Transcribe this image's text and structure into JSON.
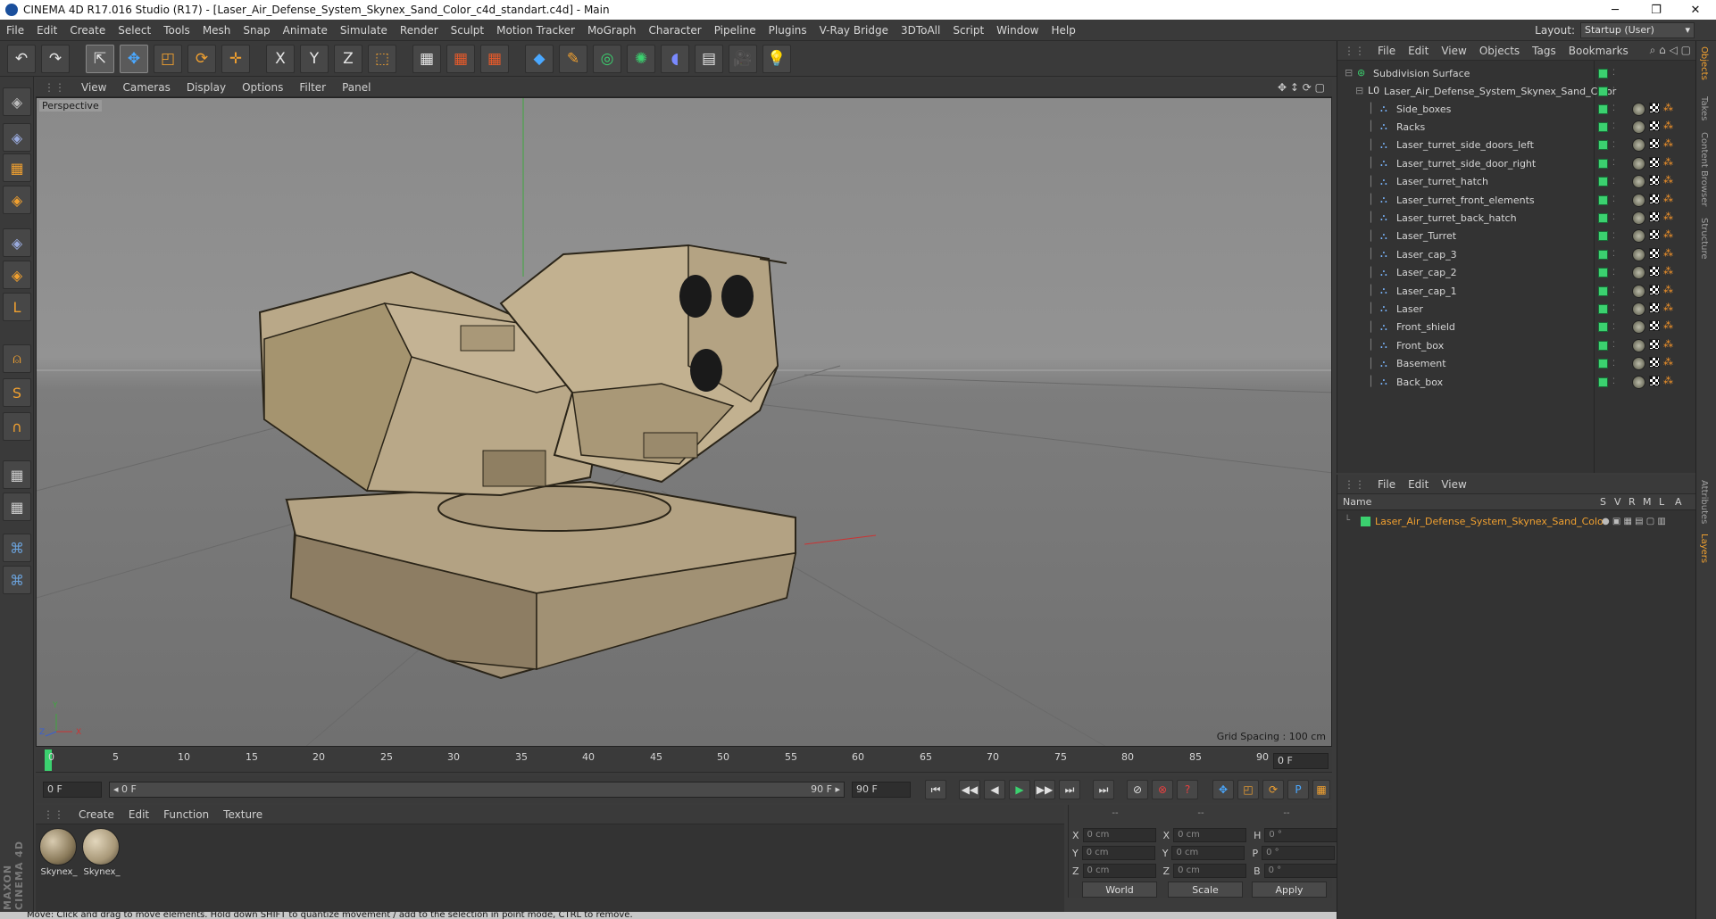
{
  "window": {
    "title": "CINEMA 4D R17.016 Studio (R17) - [Laser_Air_Defense_System_Skynex_Sand_Color_c4d_standart.c4d] - Main",
    "minimize": "─",
    "restore": "❐",
    "close": "✕"
  },
  "menu": [
    "File",
    "Edit",
    "Create",
    "Select",
    "Tools",
    "Mesh",
    "Snap",
    "Animate",
    "Simulate",
    "Render",
    "Sculpt",
    "Motion Tracker",
    "MoGraph",
    "Character",
    "Pipeline",
    "Plugins",
    "V-Ray Bridge",
    "3DToAll",
    "Script",
    "Window",
    "Help"
  ],
  "layout": {
    "label": "Layout:",
    "value": "Startup (User)"
  },
  "toolbar": {
    "undo": "↶",
    "redo": "↷",
    "select": "⇱",
    "move": "✥",
    "scale": "◰",
    "rotate": "⟳",
    "move2": "✛",
    "x": "X",
    "y": "Y",
    "z": "Z",
    "coord": "⬚",
    "render1": "▦",
    "render2": "▦",
    "render3": "▦",
    "cube": "◆",
    "pen": "✎",
    "nurbs": "◎",
    "array": "✺",
    "deform": "◖",
    "scene": "▤",
    "camera": "🎥",
    "light": "💡"
  },
  "lefttools": [
    "◈",
    "◈",
    "▦",
    "◈",
    "◈",
    "◈",
    "L",
    "⍝",
    "S",
    "∩",
    "▦",
    "▦",
    "⌘",
    "⌘"
  ],
  "maxon": "MAXON CINEMA 4D",
  "viewport": {
    "menu": [
      "View",
      "Cameras",
      "Display",
      "Options",
      "Filter",
      "Panel"
    ],
    "label": "Perspective",
    "grid": "Grid Spacing : 100 cm",
    "axes": {
      "x": "X",
      "y": "Y",
      "z": "Z"
    }
  },
  "timeline": {
    "ticks": [
      "0",
      "5",
      "10",
      "15",
      "20",
      "25",
      "30",
      "35",
      "40",
      "45",
      "50",
      "55",
      "60",
      "65",
      "70",
      "75",
      "80",
      "85",
      "90"
    ],
    "current": "0 F",
    "start": "0 F",
    "range_start": "◂ 0 F",
    "range_end": "90 F ▸",
    "end": "90 F"
  },
  "transport": [
    "⏮",
    "◀◀",
    "◀",
    "▶",
    "▶▶",
    "⏭",
    "⏭",
    "⊘",
    "⊗",
    "?",
    "✥",
    "◰",
    "⟳",
    "P",
    "▦",
    "▤"
  ],
  "materials": {
    "menu": [
      "Create",
      "Edit",
      "Function",
      "Texture"
    ],
    "items": [
      {
        "name": "Skynex_"
      },
      {
        "name": "Skynex_"
      }
    ]
  },
  "coords": {
    "head": [
      "--",
      "--",
      "--"
    ],
    "rows": [
      {
        "a": "X",
        "av": "0 cm",
        "b": "X",
        "bv": "0 cm",
        "c": "H",
        "cv": "0 °"
      },
      {
        "a": "Y",
        "av": "0 cm",
        "b": "Y",
        "bv": "0 cm",
        "c": "P",
        "cv": "0 °"
      },
      {
        "a": "Z",
        "av": "0 cm",
        "b": "Z",
        "bv": "0 cm",
        "c": "B",
        "cv": "0 °"
      }
    ],
    "space": "World",
    "mode": "Scale",
    "apply": "Apply"
  },
  "status": "Move: Click and drag to move elements. Hold down SHIFT to quantize movement / add to the selection in point mode, CTRL to remove.",
  "objects": {
    "menu": [
      "File",
      "Edit",
      "View",
      "Objects",
      "Tags",
      "Bookmarks"
    ],
    "root": "Subdivision Surface",
    "group": "Laser_Air_Defense_System_Skynex_Sand_Color",
    "children": [
      "Side_boxes",
      "Racks",
      "Laser_turret_side_doors_left",
      "Laser_turret_side_door_right",
      "Laser_turret_hatch",
      "Laser_turret_front_elements",
      "Laser_turret_back_hatch",
      "Laser_Turret",
      "Laser_cap_3",
      "Laser_cap_2",
      "Laser_cap_1",
      "Laser",
      "Front_shield",
      "Front_box",
      "Basement",
      "Back_box"
    ]
  },
  "layers": {
    "menu": [
      "File",
      "Edit",
      "View"
    ],
    "cols": [
      "Name",
      "S",
      "V",
      "R",
      "M",
      "L",
      "A"
    ],
    "item": "Laser_Air_Defense_System_Skynex_Sand_Color"
  },
  "sidetabs": [
    "Objects",
    "Takes",
    "Content Browser",
    "Structure",
    "Attributes",
    "Layers"
  ]
}
